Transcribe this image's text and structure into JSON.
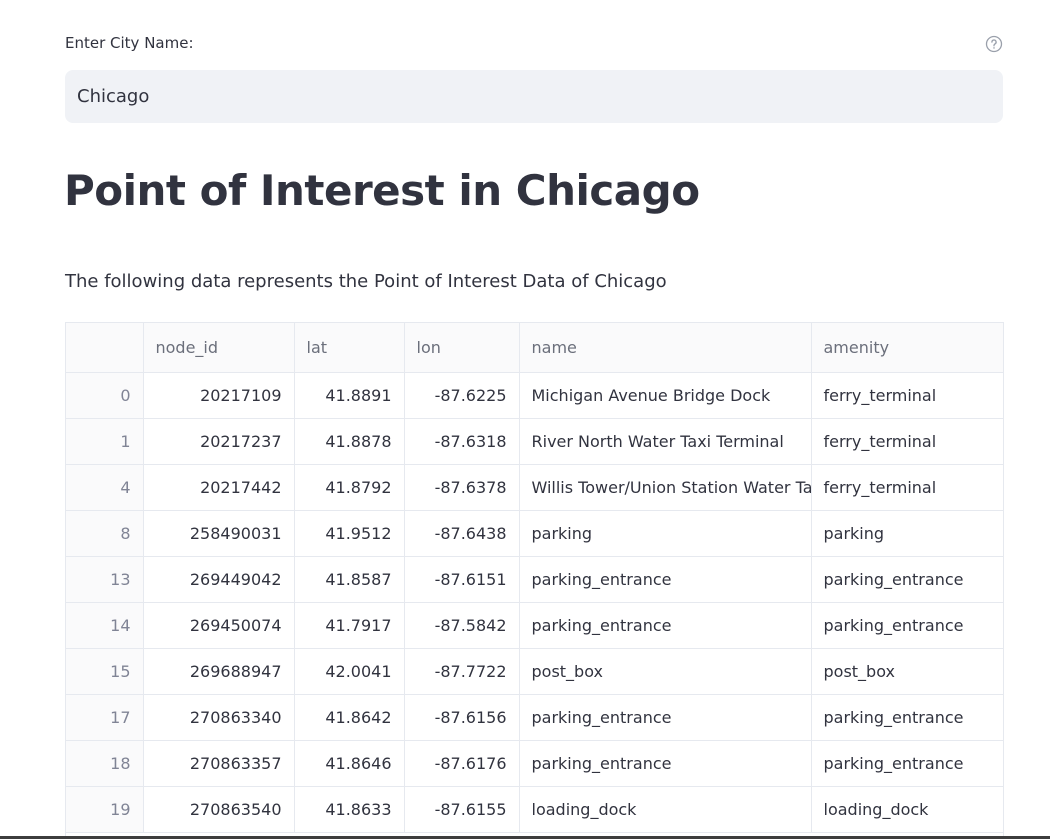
{
  "input": {
    "label": "Enter City Name:",
    "value": "Chicago"
  },
  "help_icon": "question-circle-icon",
  "title": "Point of Interest in Chicago",
  "description": "The following data represents the Point of Interest Data of Chicago",
  "table": {
    "columns": [
      "",
      "node_id",
      "lat",
      "lon",
      "name",
      "amenity"
    ],
    "rows": [
      [
        "0",
        "20217109",
        "41.8891",
        "-87.6225",
        "Michigan Avenue Bridge Dock",
        "ferry_terminal"
      ],
      [
        "1",
        "20217237",
        "41.8878",
        "-87.6318",
        "River North Water Taxi Terminal",
        "ferry_terminal"
      ],
      [
        "4",
        "20217442",
        "41.8792",
        "-87.6378",
        "Willis Tower/Union Station Water Tax",
        "ferry_terminal"
      ],
      [
        "8",
        "258490031",
        "41.9512",
        "-87.6438",
        "parking",
        "parking"
      ],
      [
        "13",
        "269449042",
        "41.8587",
        "-87.6151",
        "parking_entrance",
        "parking_entrance"
      ],
      [
        "14",
        "269450074",
        "41.7917",
        "-87.5842",
        "parking_entrance",
        "parking_entrance"
      ],
      [
        "15",
        "269688947",
        "42.0041",
        "-87.7722",
        "post_box",
        "post_box"
      ],
      [
        "17",
        "270863340",
        "41.8642",
        "-87.6156",
        "parking_entrance",
        "parking_entrance"
      ],
      [
        "18",
        "270863357",
        "41.8646",
        "-87.6176",
        "parking_entrance",
        "parking_entrance"
      ],
      [
        "19",
        "270863540",
        "41.8633",
        "-87.6155",
        "loading_dock",
        "loading_dock"
      ]
    ]
  }
}
